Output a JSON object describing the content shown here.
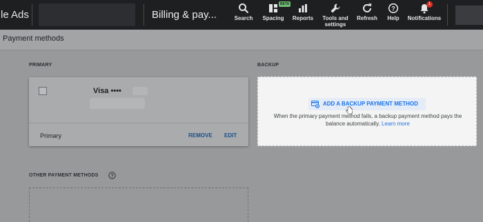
{
  "topbar": {
    "brand": "le Ads",
    "page_title": "Billing & pay...",
    "beta_badge": "BETA",
    "notif_count": "1",
    "tools": [
      {
        "label": "Search"
      },
      {
        "label": "Spacing"
      },
      {
        "label": "Reports"
      },
      {
        "label": "Tools and settings"
      },
      {
        "label": "Refresh"
      },
      {
        "label": "Help"
      },
      {
        "label": "Notifications"
      }
    ]
  },
  "header": {
    "title": "Payment methods"
  },
  "primary": {
    "section_label": "PRIMARY",
    "card_brand": "Visa ••••",
    "status": "Primary",
    "remove_label": "REMOVE",
    "edit_label": "EDIT"
  },
  "backup": {
    "section_label": "BACKUP",
    "add_label": "ADD A BACKUP PAYMENT METHOD",
    "description": "When the primary payment method fails, a backup payment method pays the balance automatically.",
    "learn_more": "Learn more"
  },
  "other": {
    "section_label": "OTHER PAYMENT METHODS"
  },
  "colors": {
    "topbar_bg": "#1d1f21",
    "accent_blue": "#1a73e8",
    "overlay_gray": "#97999b",
    "beta_green": "#6fbf73",
    "notif_red": "#d93025"
  }
}
